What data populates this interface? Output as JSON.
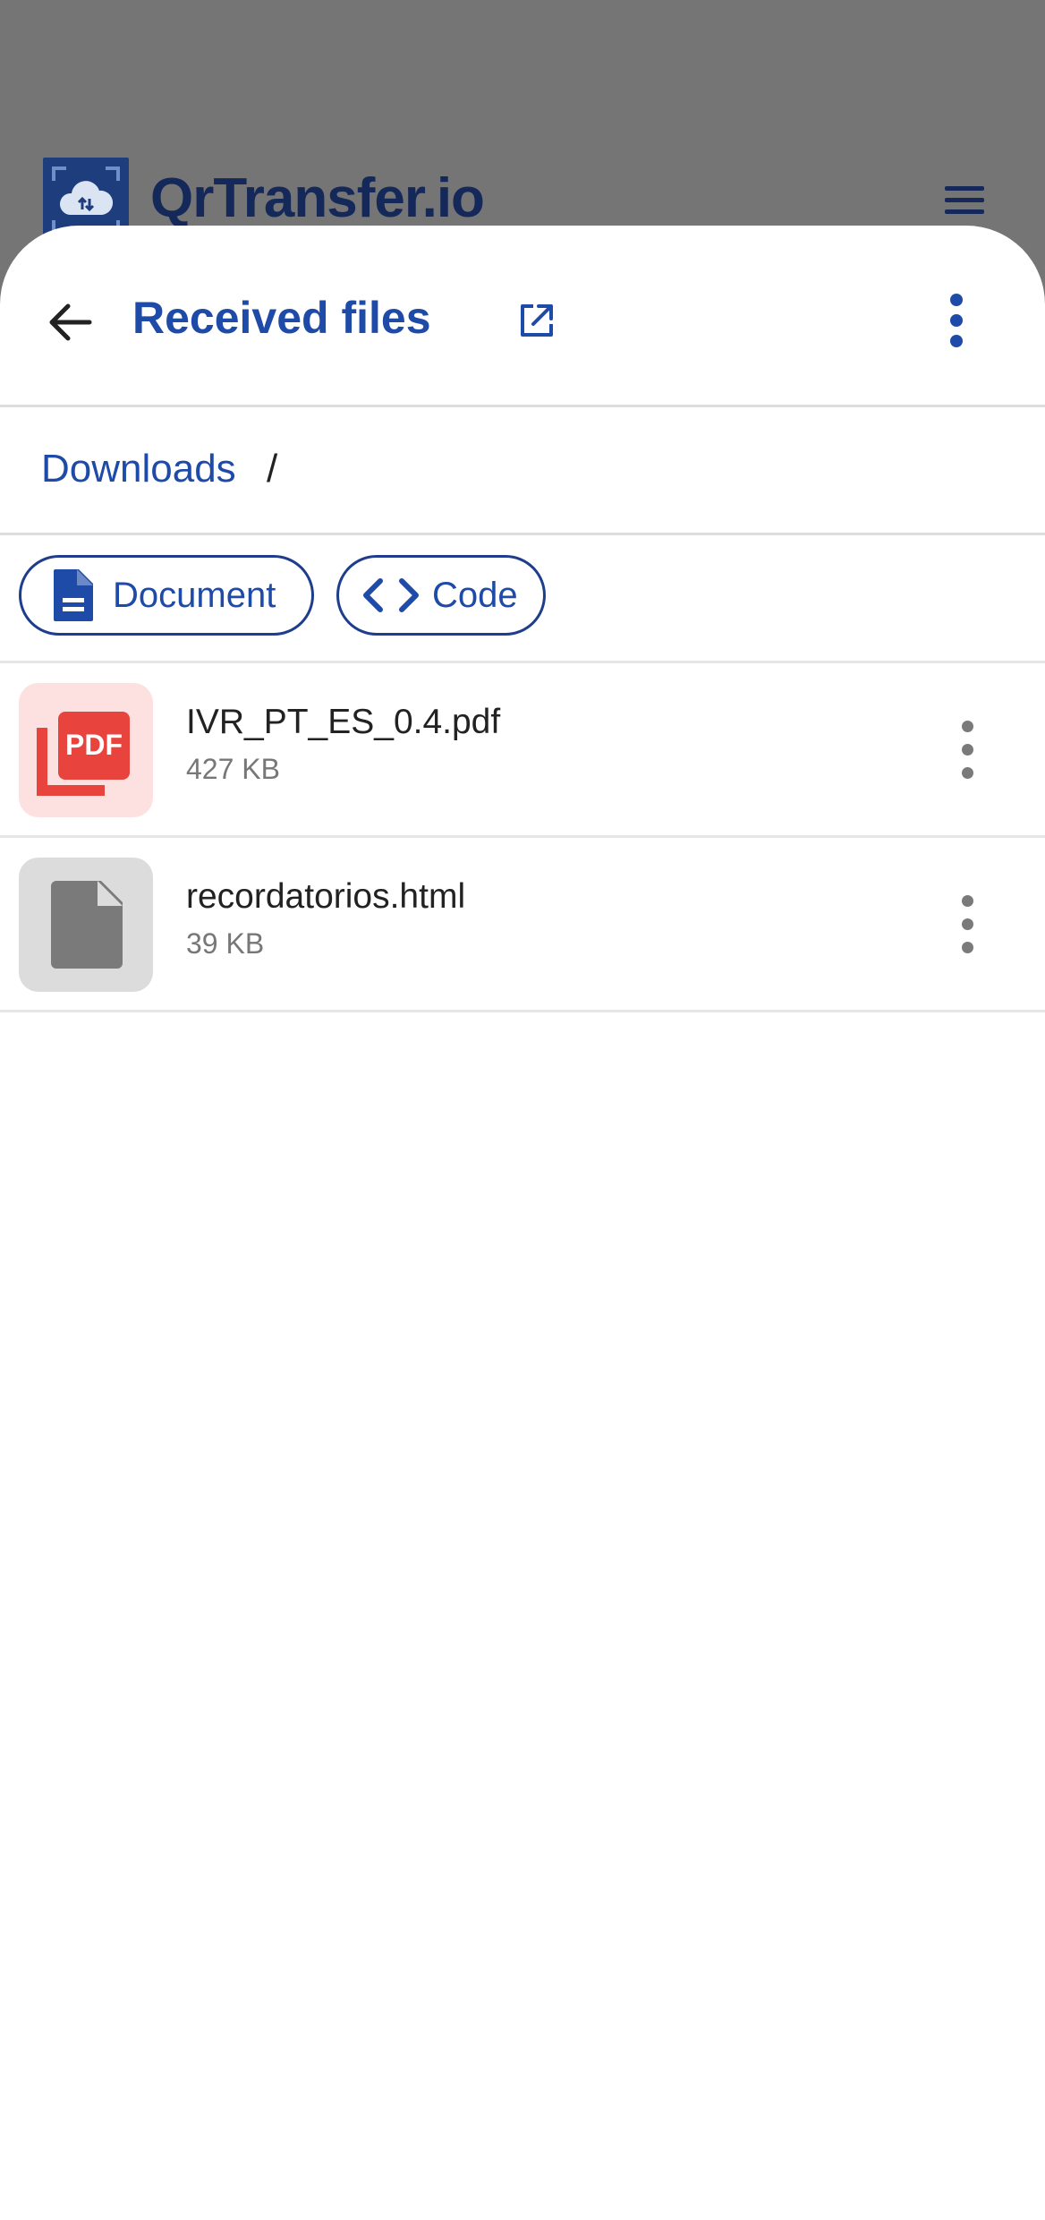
{
  "app": {
    "brand_name": "QrTransfer.io",
    "brand_color": "#1e3d7c",
    "accent_color": "#1e4aa8"
  },
  "sheet": {
    "title": "Received files",
    "back_icon": "arrow-left-icon",
    "open_icon": "open-external-icon",
    "more_icon": "more-vertical-icon"
  },
  "breadcrumb": {
    "items": [
      "Downloads"
    ],
    "separator": "/"
  },
  "filters": [
    {
      "label": "Document",
      "icon": "document-icon"
    },
    {
      "label": "Code",
      "icon": "code-icon"
    }
  ],
  "files": [
    {
      "name": "IVR_PT_ES_0.4.pdf",
      "size": "427 KB",
      "icon": "pdf-file-icon",
      "icon_color": "#e8433c"
    },
    {
      "name": "recordatorios.html",
      "size": "39 KB",
      "icon": "generic-file-icon",
      "icon_color": "#7a7a7a"
    }
  ]
}
